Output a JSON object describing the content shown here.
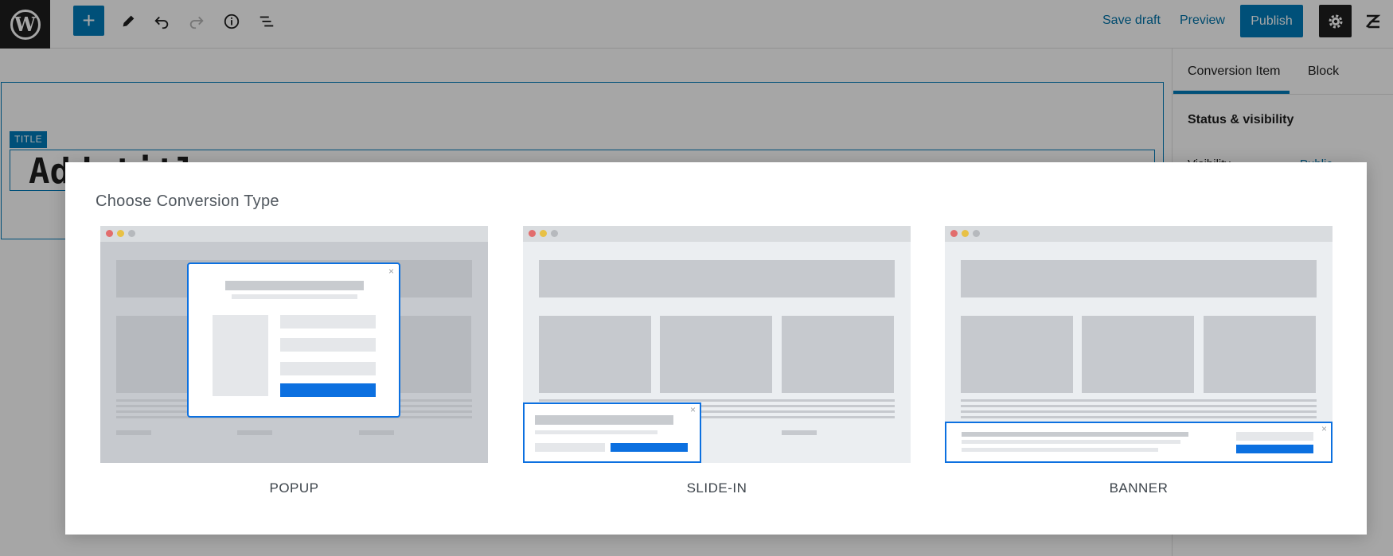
{
  "topbar": {
    "logo_letter": "W",
    "add_symbol": "+",
    "save_draft": "Save draft",
    "preview": "Preview",
    "publish": "Publish"
  },
  "icons": {
    "add": "plus-icon",
    "tools": "pencil-icon",
    "undo": "undo-icon",
    "redo": "redo-icon",
    "details": "info-icon",
    "outline": "list-view-icon",
    "settings": "gear-icon",
    "brand": "plugin-logo-icon"
  },
  "editor": {
    "title_label": "TITLE",
    "title_placeholder": "Add title"
  },
  "sidebar": {
    "tabs": [
      "Conversion Item",
      "Block"
    ],
    "active_tab": "Conversion Item",
    "panel_title": "Status & visibility",
    "visibility_label": "Visibility",
    "visibility_value": "Public"
  },
  "modal": {
    "title": "Choose Conversion Type",
    "types": [
      {
        "id": "popup",
        "label": "POPUP"
      },
      {
        "id": "slide-in",
        "label": "SLIDE-IN"
      },
      {
        "id": "banner",
        "label": "BANNER"
      }
    ]
  },
  "colors": {
    "accent": "#007cba",
    "preview_accent": "#0c70e0",
    "overlay": "rgba(0,0,0,0.35)"
  }
}
